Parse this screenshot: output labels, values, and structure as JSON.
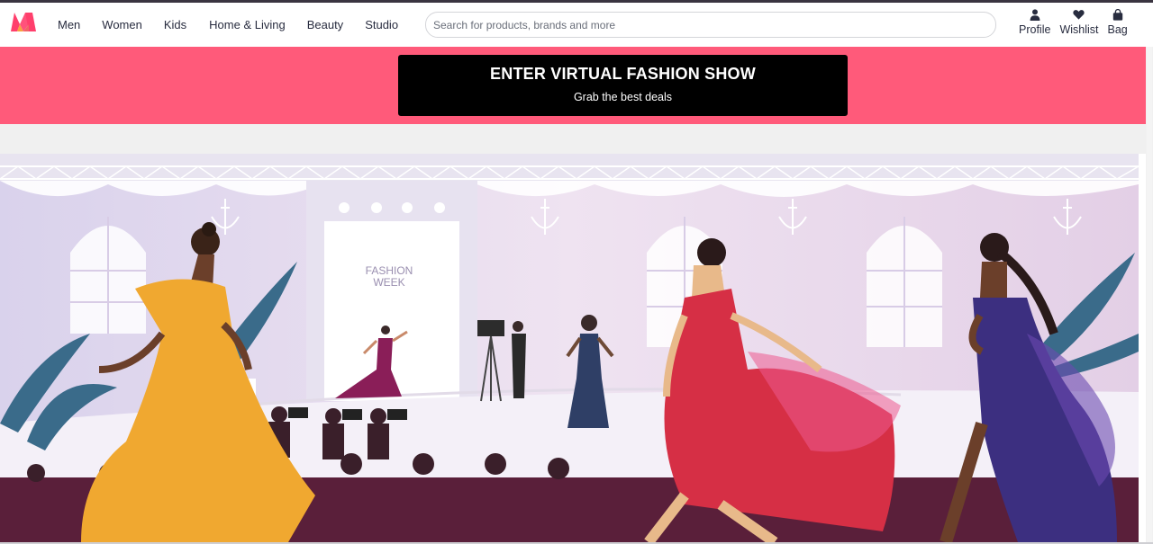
{
  "nav": {
    "items": [
      {
        "label": "Men"
      },
      {
        "label": "Women"
      },
      {
        "label": "Kids"
      },
      {
        "label": "Home & Living"
      },
      {
        "label": "Beauty"
      },
      {
        "label": "Studio"
      }
    ]
  },
  "search": {
    "placeholder": "Search for products, brands and more",
    "icon": "search-icon"
  },
  "actions": {
    "profile_label": "Profile",
    "wishlist_label": "Wishlist",
    "bag_label": "Bag",
    "icons": [
      "person-icon",
      "heart-icon",
      "bag-icon"
    ]
  },
  "promo": {
    "title": "ENTER VIRTUAL FASHION SHOW",
    "subtitle": "Grab the best deals",
    "background": "#ff5a7a",
    "button_color": "#000000"
  },
  "banner": {
    "stage_sign": [
      "FASHION",
      "WEEK"
    ]
  },
  "colors": {
    "brand_pink": "#ff3f6c",
    "brand_orange": "#f9a13f",
    "text": "#282c3f"
  }
}
